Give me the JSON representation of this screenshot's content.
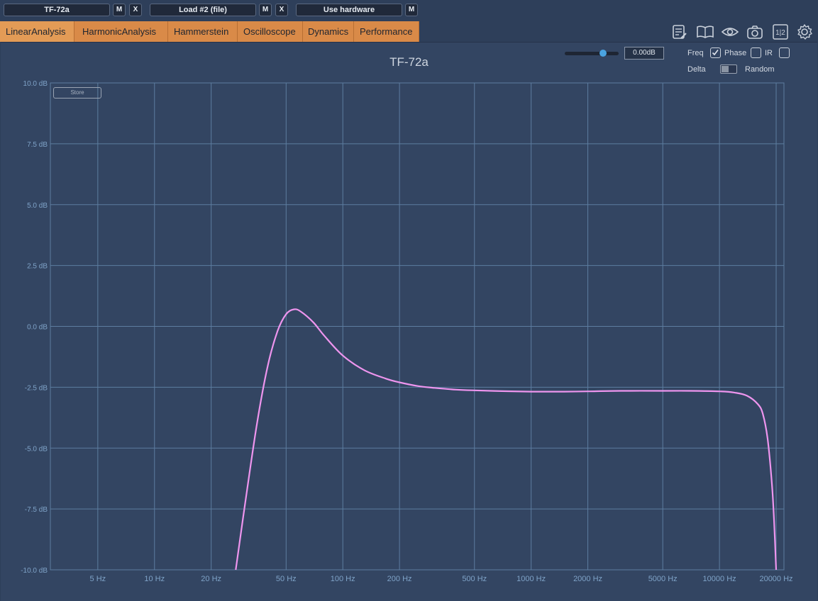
{
  "topbar": {
    "device1_label": "TF-72a",
    "device1_m": "M",
    "device1_x": "X",
    "device2_label": "Load #2 (file)",
    "device2_m": "M",
    "device2_x": "X",
    "device3_label": "Use hardware",
    "device3_m": "M"
  },
  "tabs": [
    {
      "label": "LinearAnalysis",
      "active": true
    },
    {
      "label": "HarmonicAnalysis",
      "active": false
    },
    {
      "label": "Hammerstein",
      "active": false
    },
    {
      "label": "Oscilloscope",
      "active": false
    },
    {
      "label": "Dynamics",
      "active": false
    },
    {
      "label": "Performance",
      "active": false
    }
  ],
  "toolbar_icons": [
    "notes-icon",
    "book-icon",
    "eye-icon",
    "camera-icon",
    "split-1-2-icon",
    "gear-icon"
  ],
  "split_icon_text": "1|2",
  "controls": {
    "gain_value": "0.00dB",
    "gain_level_fraction": 0.7,
    "freq_label": "Freq",
    "freq_checked": true,
    "phase_label": "Phase",
    "phase_checked": false,
    "ir_label": "IR",
    "ir_checked": false,
    "delta_label": "Delta",
    "random_label": "Random",
    "delta_random_toggle": "Delta"
  },
  "store_label": "Store",
  "colors": {
    "accent_tab": "#d98a48",
    "curve": "#ee95ee",
    "grid": "#5d7da0",
    "background": "#334562"
  },
  "chart_data": {
    "type": "line",
    "title": "TF-72a",
    "x_scale": "log",
    "xlim": [
      2.8,
      22000
    ],
    "ylim": [
      -10,
      10
    ],
    "x_ticks": [
      5,
      10,
      20,
      50,
      100,
      200,
      500,
      1000,
      2000,
      5000,
      10000,
      20000
    ],
    "x_tick_labels": [
      "5 Hz",
      "10 Hz",
      "20 Hz",
      "50 Hz",
      "100 Hz",
      "200 Hz",
      "500 Hz",
      "1000 Hz",
      "2000 Hz",
      "5000 Hz",
      "10000 Hz",
      "20000 Hz"
    ],
    "y_ticks": [
      10,
      7.5,
      5,
      2.5,
      0,
      -2.5,
      -5,
      -7.5,
      -10
    ],
    "y_tick_labels": [
      "10.0 dB",
      "7.5 dB",
      "5.0 dB",
      "2.5 dB",
      "0.0 dB",
      "-2.5 dB",
      "-5.0 dB",
      "-7.5 dB",
      "-10.0 dB"
    ],
    "grid": true,
    "series": [
      {
        "x": [
          27,
          30,
          35,
          40,
          45,
          50,
          55,
          60,
          70,
          80,
          100,
          130,
          170,
          200,
          250,
          300,
          400,
          500,
          700,
          1000,
          1500,
          2000,
          3000,
          5000,
          7000,
          10000,
          12000,
          14000,
          16000,
          17000,
          18000,
          19000,
          19500,
          20000
        ],
        "y": [
          -10,
          -7.5,
          -4.0,
          -1.6,
          -0.2,
          0.5,
          0.7,
          0.6,
          0.15,
          -0.4,
          -1.2,
          -1.8,
          -2.15,
          -2.3,
          -2.45,
          -2.52,
          -2.6,
          -2.63,
          -2.66,
          -2.68,
          -2.68,
          -2.67,
          -2.65,
          -2.65,
          -2.65,
          -2.67,
          -2.72,
          -2.85,
          -3.2,
          -3.6,
          -4.6,
          -6.5,
          -8.0,
          -10
        ]
      }
    ]
  }
}
